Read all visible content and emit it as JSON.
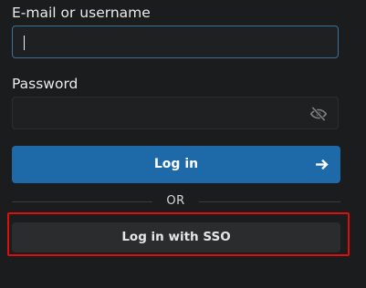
{
  "form": {
    "email_label": "E-mail or username",
    "email_value": "",
    "password_label": "Password",
    "password_value": "",
    "password_toggle_icon": "eye-off-icon",
    "login_button_label": "Log in",
    "login_button_icon": "arrow-right-icon",
    "divider_text": "OR",
    "sso_button_label": "Log in with SSO"
  },
  "colors": {
    "background": "#1b1c1e",
    "primary_button": "#1e6aa8",
    "secondary_button": "#2a2c2e",
    "focus_border": "#3e6f95",
    "highlight": "#e00d0d"
  }
}
